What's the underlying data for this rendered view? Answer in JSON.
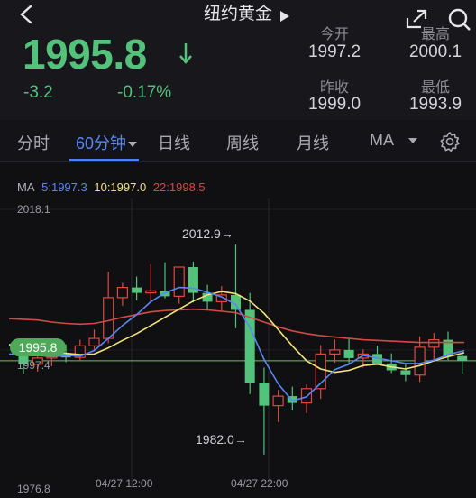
{
  "header": {
    "title": "纽约黄金",
    "price": "1995.8",
    "change": "-3.2",
    "change_pct": "-0.17%",
    "stats": [
      {
        "label": "今开",
        "value": "1997.2"
      },
      {
        "label": "最高",
        "value": "2000.1"
      },
      {
        "label": "昨收",
        "value": "1999.0"
      },
      {
        "label": "最低",
        "value": "1993.9"
      }
    ]
  },
  "tabs": [
    {
      "label": "分时"
    },
    {
      "label": "60分钟",
      "active": true
    },
    {
      "label": "日线"
    },
    {
      "label": "周线"
    },
    {
      "label": "月线"
    },
    {
      "label": "MA"
    }
  ],
  "icons": [
    "back-icon",
    "next-icon",
    "expand-icon",
    "search-icon",
    "down-arrow-icon",
    "gear-icon",
    "dropdown-caret-icon"
  ],
  "colors": {
    "up": "#e0473e",
    "down": "#53c27a",
    "accent": "#4f7ff0",
    "ma5": "#5a86f5",
    "ma10": "#f2e27a",
    "ma22": "#d24a44"
  },
  "chart_data": {
    "type": "candlestick",
    "legend": {
      "prefix": "MA",
      "ma5": "5:1997.3",
      "ma10": "10:1997.0",
      "ma22": "22:1998.5"
    },
    "ylim": [
      1976.8,
      2018.1
    ],
    "y_ticks": [
      "2018.1",
      "1997.4",
      "1976.8"
    ],
    "x_ticks": [
      "04/27 12:00",
      "04/27 22:00"
    ],
    "current_price_label": "1995.8",
    "annotations": {
      "high": "2012.9→",
      "low": "1982.0→"
    },
    "candles": [
      {
        "o": 1997.2,
        "h": 1998.6,
        "l": 1993.9,
        "c": 1995.3
      },
      {
        "o": 1995.3,
        "h": 1997.0,
        "l": 1994.2,
        "c": 1996.2
      },
      {
        "o": 1996.2,
        "h": 1997.8,
        "l": 1995.0,
        "c": 1996.9
      },
      {
        "o": 1996.9,
        "h": 1998.2,
        "l": 1995.6,
        "c": 1996.3
      },
      {
        "o": 1996.3,
        "h": 1998.9,
        "l": 1995.9,
        "c": 1998.0
      },
      {
        "o": 1998.0,
        "h": 2000.4,
        "l": 1997.2,
        "c": 1999.1
      },
      {
        "o": 1999.1,
        "h": 2008.9,
        "l": 1998.4,
        "c": 2005.1
      },
      {
        "o": 2005.1,
        "h": 2007.3,
        "l": 2003.9,
        "c": 2006.6
      },
      {
        "o": 2006.6,
        "h": 2008.2,
        "l": 2004.7,
        "c": 2005.8
      },
      {
        "o": 2005.8,
        "h": 2010.0,
        "l": 2004.6,
        "c": 2006.1
      },
      {
        "o": 2006.1,
        "h": 2010.3,
        "l": 2005.0,
        "c": 2005.3
      },
      {
        "o": 2005.3,
        "h": 2007.3,
        "l": 2004.2,
        "c": 2009.6
      },
      {
        "o": 2009.6,
        "h": 2010.4,
        "l": 2004.4,
        "c": 2005.8
      },
      {
        "o": 2005.8,
        "h": 2007.0,
        "l": 2003.3,
        "c": 2004.5
      },
      {
        "o": 2004.5,
        "h": 2006.8,
        "l": 2003.1,
        "c": 2005.5
      },
      {
        "o": 2005.5,
        "h": 2012.9,
        "l": 2000.6,
        "c": 2003.3
      },
      {
        "o": 2003.3,
        "h": 2005.8,
        "l": 1990.9,
        "c": 1992.6
      },
      {
        "o": 1992.6,
        "h": 1994.8,
        "l": 1982.0,
        "c": 1989.2
      },
      {
        "o": 1989.2,
        "h": 1991.5,
        "l": 1986.8,
        "c": 1990.6
      },
      {
        "o": 1990.6,
        "h": 1992.0,
        "l": 1988.5,
        "c": 1989.6
      },
      {
        "o": 1989.6,
        "h": 1992.3,
        "l": 1988.1,
        "c": 1991.7
      },
      {
        "o": 1991.7,
        "h": 1998.1,
        "l": 1990.2,
        "c": 1996.8
      },
      {
        "o": 1996.8,
        "h": 1998.9,
        "l": 1995.5,
        "c": 1997.4
      },
      {
        "o": 1997.4,
        "h": 1999.2,
        "l": 1995.4,
        "c": 1996.2
      },
      {
        "o": 1996.2,
        "h": 1997.5,
        "l": 1994.8,
        "c": 1996.8
      },
      {
        "o": 1996.8,
        "h": 1998.0,
        "l": 1995.7,
        "c": 1995.4
      },
      {
        "o": 1995.4,
        "h": 1996.9,
        "l": 1994.0,
        "c": 1994.4
      },
      {
        "o": 1994.4,
        "h": 1995.3,
        "l": 1992.8,
        "c": 1993.7
      },
      {
        "o": 1993.7,
        "h": 1999.4,
        "l": 1992.7,
        "c": 1997.8
      },
      {
        "o": 1997.8,
        "h": 1999.9,
        "l": 1996.0,
        "c": 1998.9
      },
      {
        "o": 1998.9,
        "h": 2000.1,
        "l": 1995.9,
        "c": 1996.5
      },
      {
        "o": 1996.5,
        "h": 1997.2,
        "l": 1993.9,
        "c": 1995.8
      }
    ],
    "ma": {
      "ma5": [
        1996.8,
        1996.6,
        1996.4,
        1996.6,
        1996.5,
        1997.3,
        1999.1,
        2001.0,
        2002.6,
        2004.5,
        2005.8,
        2006.6,
        2006.5,
        2005.9,
        2005.2,
        2004.1,
        2000.7,
        1996.0,
        1992.4,
        1989.9,
        1990.5,
        1992.5,
        1994.5,
        1995.3,
        1996.6,
        1996.2,
        1995.8,
        1995.4,
        1995.4,
        1995.9,
        1996.7,
        1997.3
      ],
      "ma10": [
        1998.2,
        1997.7,
        1997.3,
        1996.9,
        1996.7,
        1996.8,
        1997.7,
        1998.8,
        1999.8,
        2001.0,
        2002.2,
        2003.4,
        2004.6,
        2005.5,
        2006.0,
        2005.7,
        2004.6,
        2002.8,
        2000.4,
        1998.0,
        1995.8,
        1994.6,
        1994.1,
        1994.4,
        1995.1,
        1995.3,
        1994.9,
        1994.6,
        1995.1,
        1995.8,
        1996.4,
        1997.0
      ],
      "ma22": [
        2002.0,
        2001.8,
        2001.5,
        2001.3,
        2001.2,
        2001.3,
        2001.7,
        2002.2,
        2002.6,
        2003.0,
        2003.2,
        2003.3,
        2003.4,
        2003.3,
        2003.1,
        2002.9,
        2002.2,
        2001.5,
        2000.8,
        2000.2,
        1999.8,
        1999.5,
        1999.3,
        1999.1,
        1998.9,
        1998.8,
        1998.7,
        1998.6,
        1998.5,
        1998.5,
        1998.5,
        1998.5
      ]
    }
  }
}
